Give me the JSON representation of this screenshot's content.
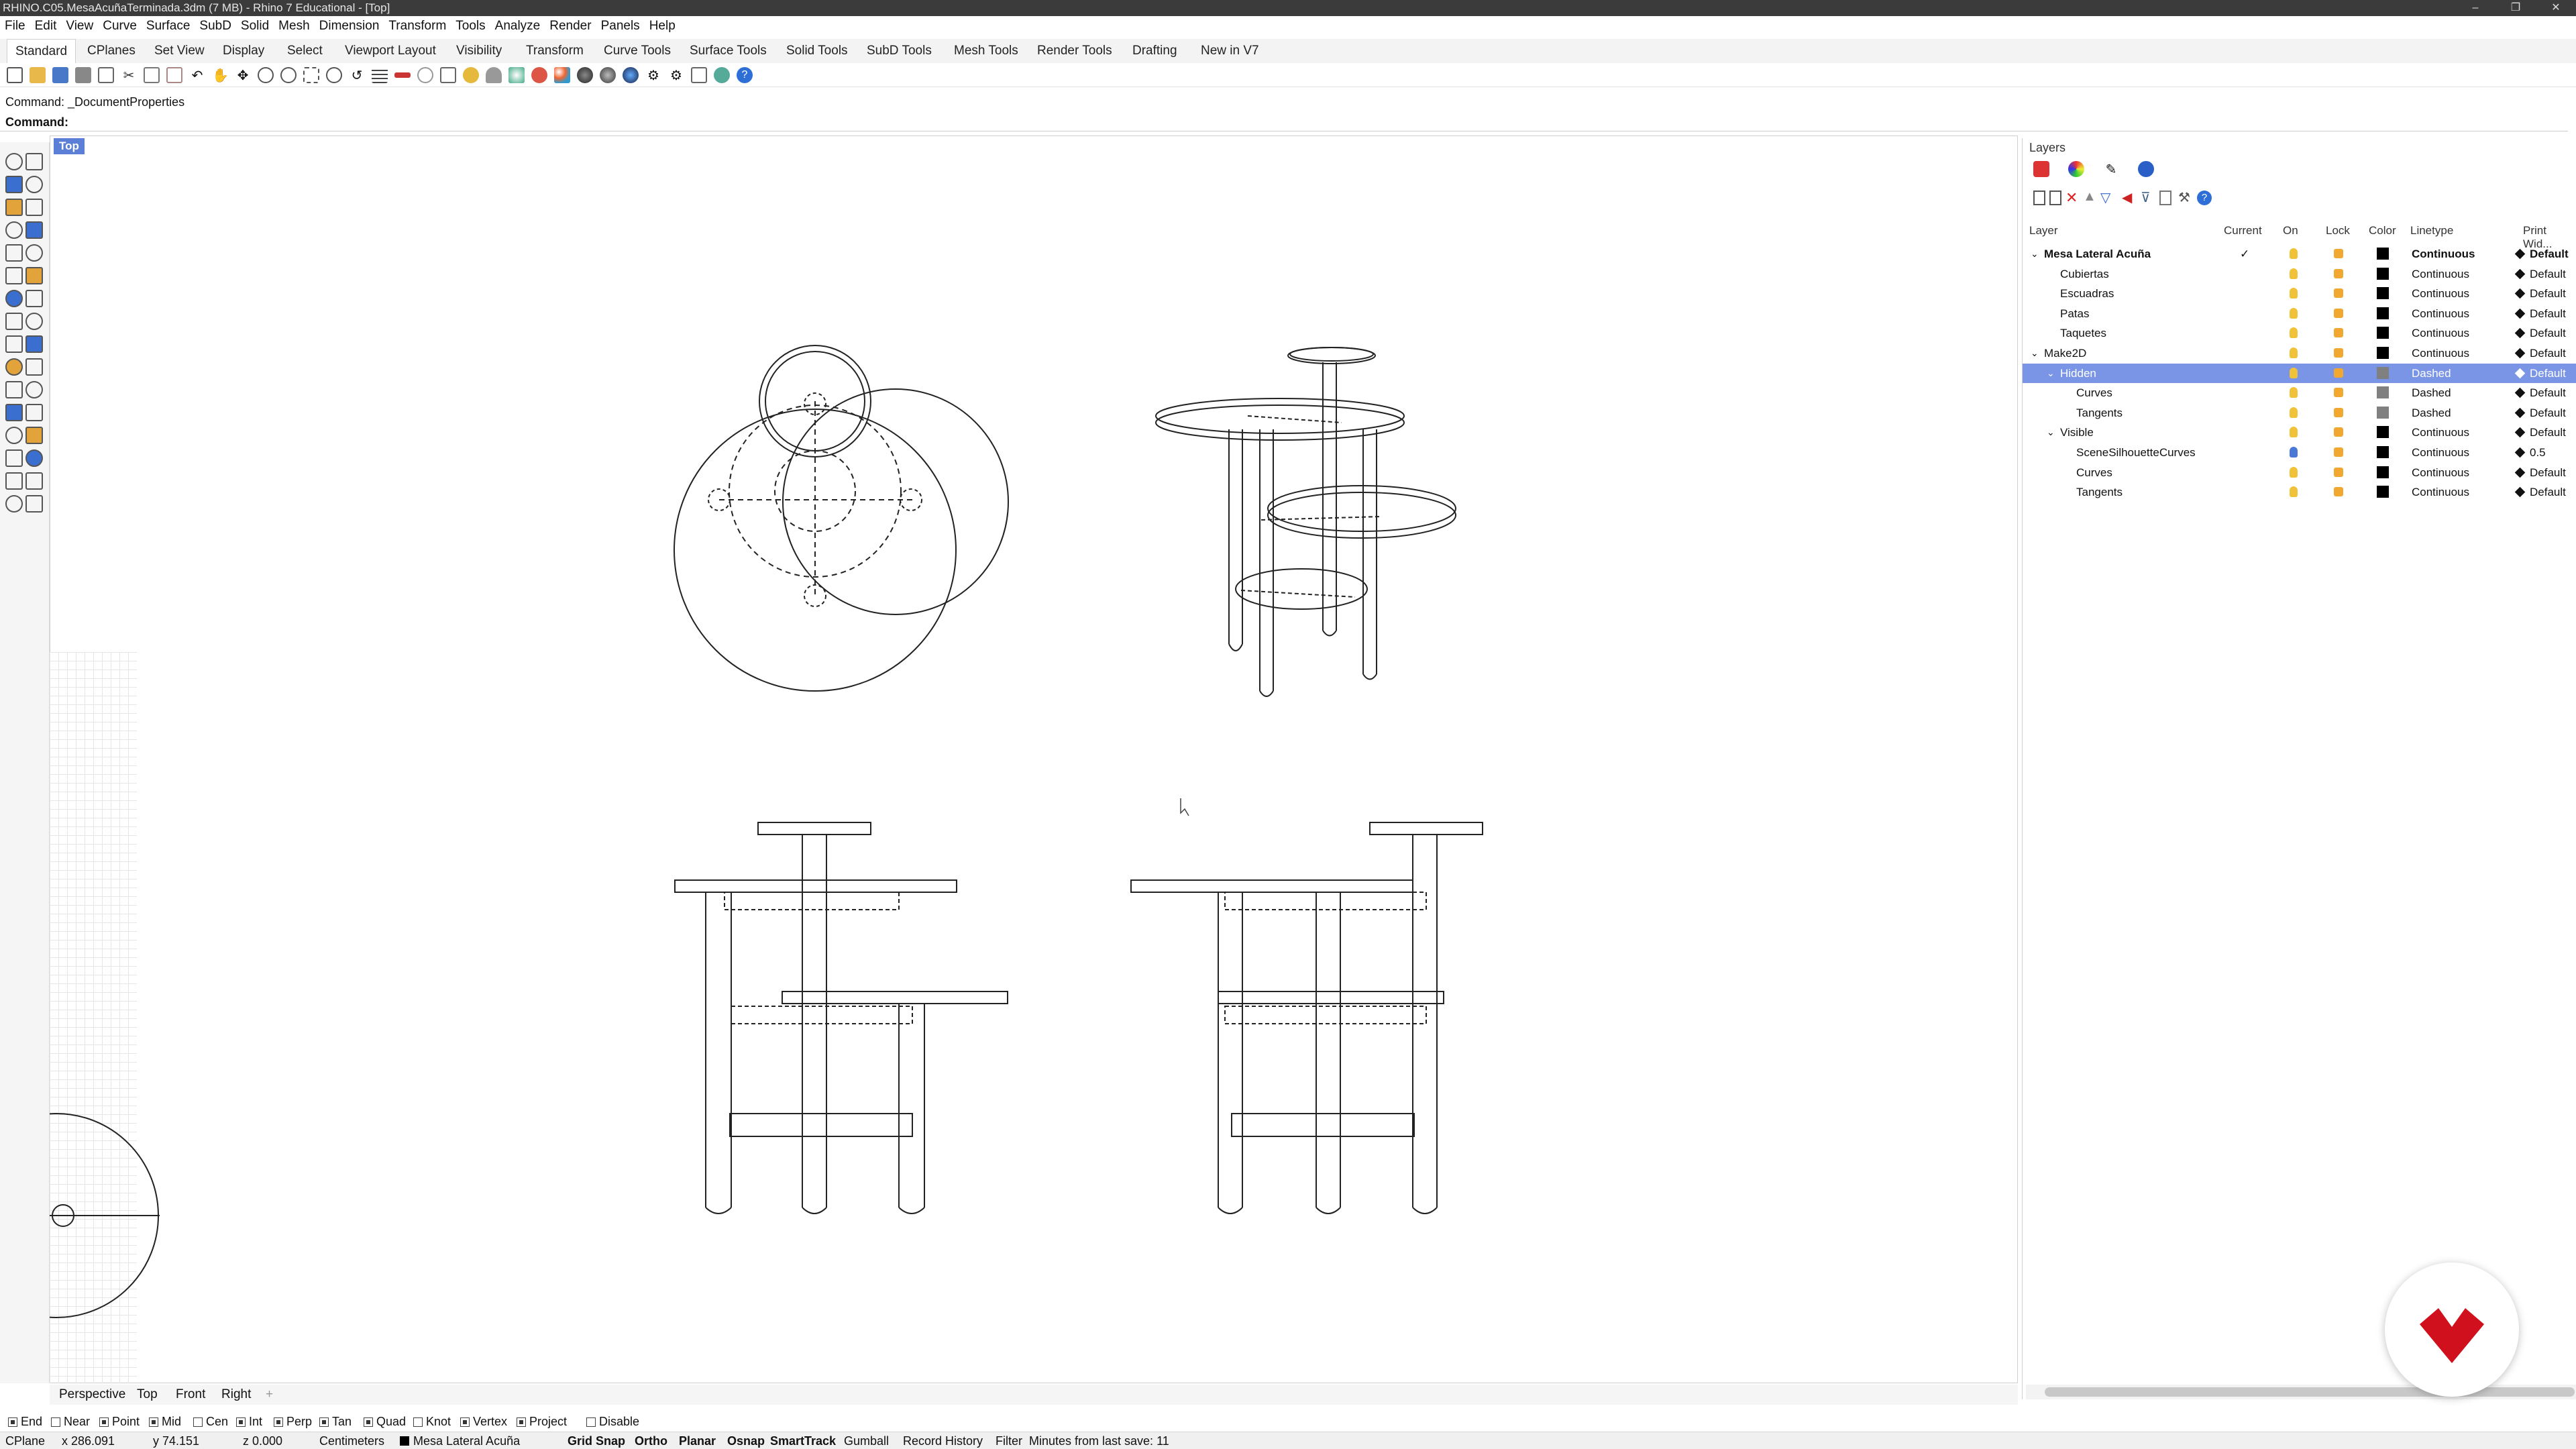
{
  "window": {
    "title": "RHINO.C05.MesaAcuñaTerminada.3dm (7 MB) - Rhino 7 Educational - [Top]",
    "controls": [
      "–",
      "❐",
      "✕"
    ]
  },
  "menu": [
    "File",
    "Edit",
    "View",
    "Curve",
    "Surface",
    "SubD",
    "Solid",
    "Mesh",
    "Dimension",
    "Transform",
    "Tools",
    "Analyze",
    "Render",
    "Panels",
    "Help"
  ],
  "tabs": [
    "Standard",
    "CPlanes",
    "Set View",
    "Display",
    "Select",
    "Viewport Layout",
    "Visibility",
    "Transform",
    "Curve Tools",
    "Surface Tools",
    "Solid Tools",
    "SubD Tools",
    "Mesh Tools",
    "Render Tools",
    "Drafting",
    "New in V7"
  ],
  "command": {
    "history": "Command: _DocumentProperties",
    "prompt": "Command:"
  },
  "viewport": {
    "label": "Top",
    "tabs": [
      "Perspective",
      "Top",
      "Front",
      "Right"
    ],
    "add": "+"
  },
  "osnaps": [
    {
      "label": "End",
      "checked": true
    },
    {
      "label": "Near",
      "checked": false
    },
    {
      "label": "Point",
      "checked": true
    },
    {
      "label": "Mid",
      "checked": true
    },
    {
      "label": "Cen",
      "checked": false
    },
    {
      "label": "Int",
      "checked": true
    },
    {
      "label": "Perp",
      "checked": true
    },
    {
      "label": "Tan",
      "checked": true
    },
    {
      "label": "Quad",
      "checked": true
    },
    {
      "label": "Knot",
      "checked": false
    },
    {
      "label": "Vertex",
      "checked": true
    },
    {
      "label": "Project",
      "checked": true
    },
    {
      "label": "Disable",
      "checked": false
    }
  ],
  "status": {
    "cplane": "CPlane",
    "x": "x 286.091",
    "y": "y 74.151",
    "z": "z 0.000",
    "units": "Centimeters",
    "layer": "Mesa Lateral Acuña",
    "grid_snap": "Grid Snap",
    "ortho": "Ortho",
    "planar": "Planar",
    "osnap": "Osnap",
    "smarttrack": "SmartTrack",
    "gumball": "Gumball",
    "record": "Record History",
    "filter": "Filter",
    "save": "Minutes from last save: 11"
  },
  "layers_panel": {
    "title": "Layers",
    "headers": [
      "Layer",
      "Current",
      "On",
      "Lock",
      "Color",
      "Linetype",
      "Print Wid..."
    ],
    "rows": [
      {
        "name": "Mesa Lateral Acuña",
        "indent": 0,
        "expander": "v",
        "current": "✓",
        "color": "#000000",
        "linetype": "Continuous",
        "width": "Default",
        "bold": true
      },
      {
        "name": "Cubiertas",
        "indent": 1,
        "expander": "",
        "current": "",
        "color": "#000000",
        "linetype": "Continuous",
        "width": "Default"
      },
      {
        "name": "Escuadras",
        "indent": 1,
        "expander": "",
        "current": "",
        "color": "#000000",
        "linetype": "Continuous",
        "width": "Default"
      },
      {
        "name": "Patas",
        "indent": 1,
        "expander": "",
        "current": "",
        "color": "#000000",
        "linetype": "Continuous",
        "width": "Default"
      },
      {
        "name": "Taquetes",
        "indent": 1,
        "expander": "",
        "current": "",
        "color": "#000000",
        "linetype": "Continuous",
        "width": "Default"
      },
      {
        "name": "Make2D",
        "indent": 0,
        "expander": "v",
        "current": "",
        "color": "#000000",
        "linetype": "Continuous",
        "width": "Default"
      },
      {
        "name": "Hidden",
        "indent": 1,
        "expander": "v",
        "current": "",
        "color": "#808080",
        "linetype": "Dashed",
        "width": "Default",
        "selected": true
      },
      {
        "name": "Curves",
        "indent": 2,
        "expander": "",
        "current": "",
        "color": "#808080",
        "linetype": "Dashed",
        "width": "Default"
      },
      {
        "name": "Tangents",
        "indent": 2,
        "expander": "",
        "current": "",
        "color": "#808080",
        "linetype": "Dashed",
        "width": "Default"
      },
      {
        "name": "Visible",
        "indent": 1,
        "expander": "v",
        "current": "",
        "color": "#000000",
        "linetype": "Continuous",
        "width": "Default"
      },
      {
        "name": "SceneSilhouetteCurves",
        "indent": 2,
        "expander": "",
        "current": "",
        "color": "#000000",
        "linetype": "Continuous",
        "width": "0.5"
      },
      {
        "name": "Curves",
        "indent": 2,
        "expander": "",
        "current": "",
        "color": "#000000",
        "linetype": "Continuous",
        "width": "Default"
      },
      {
        "name": "Tangents",
        "indent": 2,
        "expander": "",
        "current": "",
        "color": "#000000",
        "linetype": "Continuous",
        "width": "Default"
      }
    ]
  },
  "icons": {
    "layer_toolbar": [
      "new-layer-icon",
      "new-sublayer-icon",
      "delete-layer-icon",
      "move-up-icon",
      "move-down-icon",
      "move-to-parent-icon",
      "filter-icon",
      "properties-icon",
      "tools-icon",
      "help-icon"
    ]
  },
  "brand_color": "#d0101c"
}
